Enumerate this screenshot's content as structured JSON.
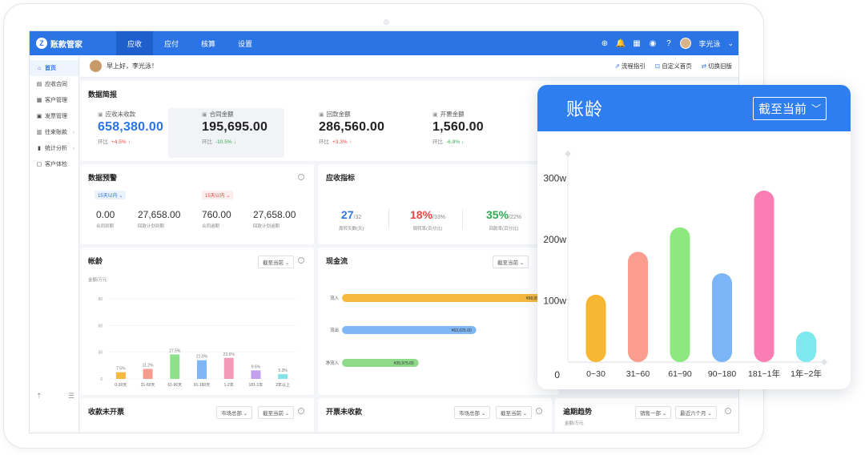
{
  "app": {
    "logo_glyph": "Z",
    "name": "账款管家",
    "nav": [
      "应收",
      "应付",
      "核算",
      "设置"
    ],
    "active_nav": 0,
    "user": "李光泳"
  },
  "sidebar": {
    "items": [
      {
        "icon": "home-icon",
        "glyph": "⌂",
        "label": "首页",
        "active": true,
        "chev": false
      },
      {
        "icon": "contract-icon",
        "glyph": "▤",
        "label": "应收合同",
        "active": false,
        "chev": false
      },
      {
        "icon": "customer-icon",
        "glyph": "▦",
        "label": "客户管理",
        "active": false,
        "chev": false
      },
      {
        "icon": "invoice-icon",
        "glyph": "▣",
        "label": "发票管理",
        "active": false,
        "chev": false
      },
      {
        "icon": "account-icon",
        "glyph": "▥",
        "label": "往来账款",
        "active": false,
        "chev": true
      },
      {
        "icon": "stats-icon",
        "glyph": "▮",
        "label": "统计分析",
        "active": false,
        "chev": true
      },
      {
        "icon": "checkup-icon",
        "glyph": "▢",
        "label": "客户体检",
        "active": false,
        "chev": false
      }
    ]
  },
  "greeting": {
    "text": "早上好，李光泳！",
    "links": [
      {
        "icon": "flow-icon",
        "glyph": "⇗",
        "label": "流程指引"
      },
      {
        "icon": "custom-home-icon",
        "glyph": "⊡",
        "label": "自定义首页"
      },
      {
        "icon": "switch-icon",
        "glyph": "⇄",
        "label": "切换旧版"
      }
    ]
  },
  "summary": {
    "title": "数据简报",
    "kpis": [
      {
        "label": "应收未收款",
        "value": "658,380.00",
        "compare_label": "环比",
        "change": "+4.5%",
        "dir": "up",
        "blue": true
      },
      {
        "label": "合同金额",
        "value": "195,695.00",
        "compare_label": "环比",
        "change": "-10.5%",
        "dir": "down",
        "blue": false
      },
      {
        "label": "回款金额",
        "value": "286,560.00",
        "compare_label": "环比",
        "change": "+3.3%",
        "dir": "up",
        "blue": false
      },
      {
        "label": "开票金额",
        "value": "1,560.00",
        "compare_label": "环比",
        "change": "-6.9%",
        "dir": "down",
        "blue": false
      }
    ]
  },
  "warning": {
    "title": "数据预警",
    "tag1": "15天以内",
    "tag2": "15天以内",
    "items": [
      {
        "value": "0.00",
        "label": "合同到期"
      },
      {
        "value": "27,658.00",
        "label": "回款计划到期"
      },
      {
        "value": "760.00",
        "label": "合同逾期"
      },
      {
        "value": "27,658.00",
        "label": "回款计划逾期"
      }
    ]
  },
  "indicator": {
    "title": "应收指标",
    "items": [
      {
        "value": "27",
        "sub": "/32",
        "label": "周转天数(天)",
        "color": "#2b74e6"
      },
      {
        "value": "18%",
        "sub": "/33%",
        "label": "周转率(百分比)",
        "color": "#e84545"
      },
      {
        "value": "35%",
        "sub": "/22%",
        "label": "回款率(百分比)",
        "color": "#2fa84f"
      }
    ]
  },
  "aging": {
    "title": "帐龄",
    "dropdown": "截至当前",
    "unit": "金额/万元"
  },
  "cashflow": {
    "title": "现金流",
    "dropdown": "截至当前"
  },
  "bottom": {
    "c1": {
      "title": "收款未开票",
      "dd1": "市场总部",
      "dd2": "截至当前"
    },
    "c2": {
      "title": "开票未收款",
      "dd1": "市场总部",
      "dd2": "截至当前"
    },
    "c3": {
      "title": "逾期趋势",
      "dd1": "销售一部",
      "dd2": "最近六个月",
      "unit": "金额/万元"
    }
  },
  "popup": {
    "title": "账龄",
    "dropdown": "截至当前"
  },
  "chart_data": [
    {
      "type": "bar",
      "title": "帐龄",
      "ylabel": "金额/万元",
      "categories": [
        "0-30天",
        "31-60天",
        "61-90天",
        "91-180天",
        "1-2年",
        "181-1年",
        "2年以上"
      ],
      "values": [
        7.5,
        11.2,
        27.5,
        21.0,
        23.6,
        9.6,
        5.3
      ],
      "data_labels": [
        "7.5%",
        "11.2%",
        "27.5%",
        "21.0%",
        "23.6%",
        "9.6%",
        "5.3%"
      ],
      "yticks": [
        0,
        30,
        60,
        90
      ],
      "ylim": [
        0,
        90
      ],
      "colors": [
        "#f5b93f",
        "#f59b8f",
        "#8fe08a",
        "#7fb7f5",
        "#f39ab8",
        "#c3a0ee",
        "#84e3e6"
      ]
    },
    {
      "type": "bar",
      "orientation": "horizontal",
      "title": "现金流",
      "categories": [
        "流入",
        "流出",
        "净流入"
      ],
      "values": [
        98050.65,
        63025.0,
        35975.65
      ],
      "data_labels": [
        "¥98,050.65",
        "¥63,025.00",
        "¥35,975.65"
      ],
      "xlim": [
        0,
        100000
      ],
      "colors": [
        "#f5b93f",
        "#7fb7f5",
        "#8fd98a"
      ]
    },
    {
      "type": "bar",
      "title": "账龄",
      "categories": [
        "0~30",
        "31~60",
        "61~90",
        "90~180",
        "181~1年",
        "1年~2年"
      ],
      "values": [
        110,
        180,
        220,
        145,
        280,
        50
      ],
      "yticks": [
        "100w",
        "200w",
        "300w"
      ],
      "ytick_values": [
        100,
        200,
        300
      ],
      "zero_label": "0",
      "ylim": [
        0,
        340
      ],
      "colors": [
        "#f7b733",
        "#fa9c8e",
        "#8de87f",
        "#7cb5f7",
        "#fa7db3",
        "#7de9ee"
      ]
    }
  ]
}
